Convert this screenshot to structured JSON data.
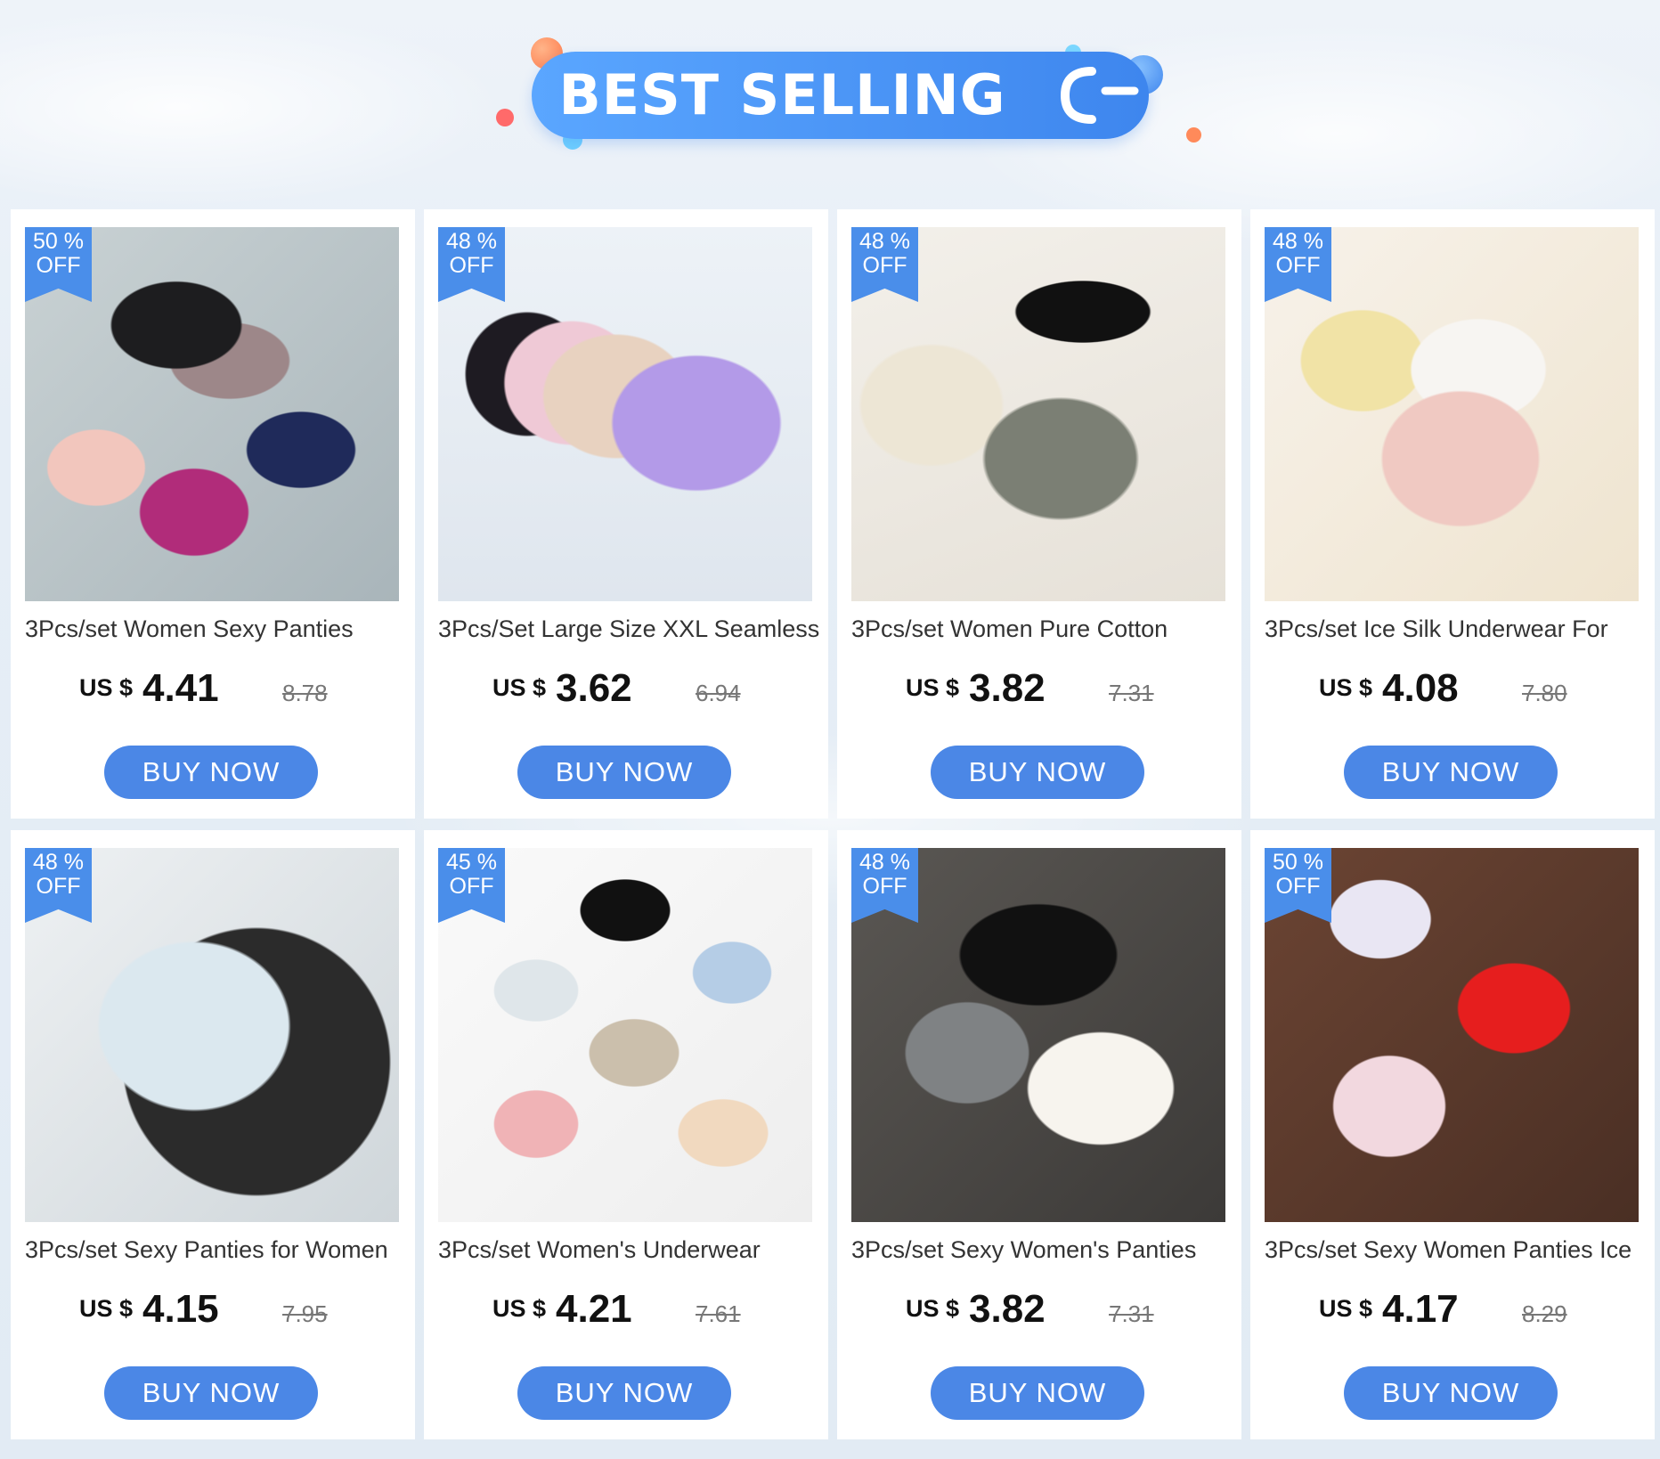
{
  "header": {
    "title": "BEST SELLING",
    "accent_color": "#4a8eea"
  },
  "products": [
    {
      "discount": "50 %",
      "off": "OFF",
      "title": "3Pcs/set Women Sexy Panties",
      "currency": "US $",
      "price": "4.41",
      "original_price": "8.78",
      "buy_label": "BUY NOW"
    },
    {
      "discount": "48 %",
      "off": "OFF",
      "title": "3Pcs/Set Large Size XXL Seamless",
      "currency": "US $",
      "price": "3.62",
      "original_price": "6.94",
      "buy_label": "BUY NOW"
    },
    {
      "discount": "48 %",
      "off": "OFF",
      "title": "3Pcs/set Women Pure Cotton",
      "currency": "US $",
      "price": "3.82",
      "original_price": "7.31",
      "buy_label": "BUY NOW"
    },
    {
      "discount": "48 %",
      "off": "OFF",
      "title": "3Pcs/set Ice Silk Underwear For",
      "currency": "US $",
      "price": "4.08",
      "original_price": "7.80",
      "buy_label": "BUY NOW"
    },
    {
      "discount": "48 %",
      "off": "OFF",
      "title": "3Pcs/set Sexy Panties for Women",
      "currency": "US $",
      "price": "4.15",
      "original_price": "7.95",
      "buy_label": "BUY NOW"
    },
    {
      "discount": "45 %",
      "off": "OFF",
      "title": "3Pcs/set Women's Underwear",
      "currency": "US $",
      "price": "4.21",
      "original_price": "7.61",
      "buy_label": "BUY NOW"
    },
    {
      "discount": "48 %",
      "off": "OFF",
      "title": "3Pcs/set Sexy Women's Panties",
      "currency": "US $",
      "price": "3.82",
      "original_price": "7.31",
      "buy_label": "BUY NOW"
    },
    {
      "discount": "50 %",
      "off": "OFF",
      "title": "3Pcs/set Sexy Women Panties Ice",
      "currency": "US $",
      "price": "4.17",
      "original_price": "8.29",
      "buy_label": "BUY NOW"
    }
  ],
  "product_image_icons": [
    "product-photo-icon"
  ]
}
